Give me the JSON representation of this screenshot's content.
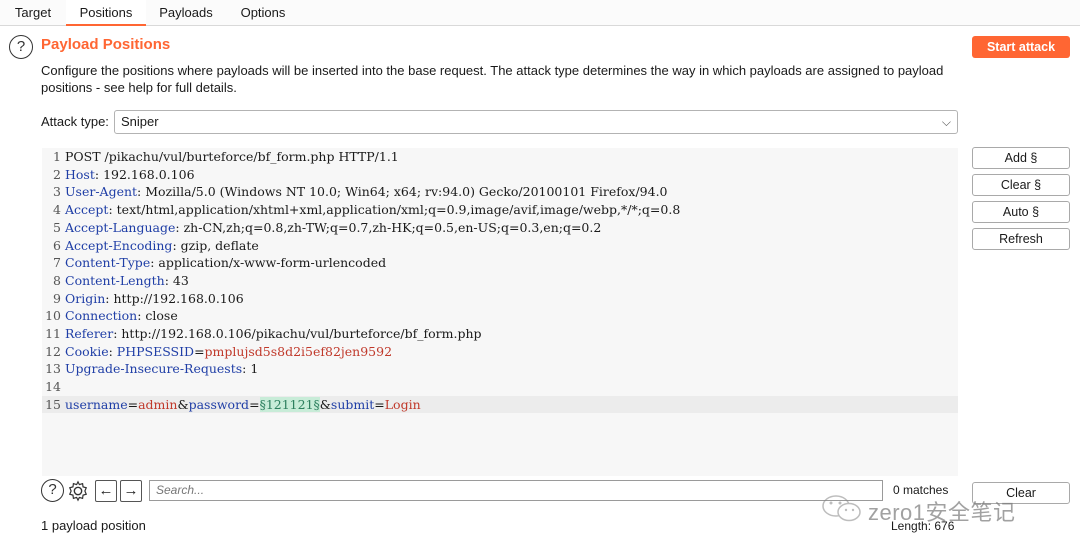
{
  "tabs": [
    {
      "label": "Target",
      "active": false
    },
    {
      "label": "Positions",
      "active": true
    },
    {
      "label": "Payloads",
      "active": false
    },
    {
      "label": "Options",
      "active": false
    }
  ],
  "header": {
    "title": "Payload Positions",
    "start_attack_label": "Start attack",
    "description": "Configure the positions where payloads will be inserted into the base request. The attack type determines the way in which payloads are assigned to payload positions - see help for full details."
  },
  "attack_type": {
    "label": "Attack type:",
    "value": "Sniper"
  },
  "request_lines": [
    {
      "num": "1",
      "text": "POST /pikachu/vul/burteforce/bf_form.php HTTP/1.1"
    },
    {
      "num": "2",
      "name": "Host",
      "value": " 192.168.0.106"
    },
    {
      "num": "3",
      "name": "User-Agent",
      "value": " Mozilla/5.0 (Windows NT 10.0; Win64; x64; rv:94.0) Gecko/20100101 Firefox/94.0"
    },
    {
      "num": "4",
      "name": "Accept",
      "value": " text/html,application/xhtml+xml,application/xml;q=0.9,image/avif,image/webp,*/*;q=0.8"
    },
    {
      "num": "5",
      "name": "Accept-Language",
      "value": " zh-CN,zh;q=0.8,zh-TW;q=0.7,zh-HK;q=0.5,en-US;q=0.3,en;q=0.2"
    },
    {
      "num": "6",
      "name": "Accept-Encoding",
      "value": " gzip, deflate"
    },
    {
      "num": "7",
      "name": "Content-Type",
      "value": " application/x-www-form-urlencoded"
    },
    {
      "num": "8",
      "name": "Content-Length",
      "value": " 43"
    },
    {
      "num": "9",
      "name": "Origin",
      "value": " http://192.168.0.106"
    },
    {
      "num": "10",
      "name": "Connection",
      "value": " close"
    },
    {
      "num": "11",
      "name": "Referer",
      "value": " http://192.168.0.106/pikachu/vul/burteforce/bf_form.php"
    },
    {
      "num": "12",
      "name": "Cookie",
      "cookie_name": "PHPSESSID",
      "cookie_value": "pmplujsd5s8d2i5ef82jen9592"
    },
    {
      "num": "13",
      "name": "Upgrade-Insecure-Requests",
      "value": " 1"
    },
    {
      "num": "14",
      "text": ""
    },
    {
      "num": "15",
      "body": {
        "p1": "username",
        "v1": "admin",
        "p2": "password",
        "marked": "§121121§",
        "p3": "submit",
        "v3": "Login"
      }
    }
  ],
  "side_buttons": {
    "add": "Add §",
    "clear": "Clear §",
    "auto": "Auto §",
    "refresh": "Refresh"
  },
  "search": {
    "placeholder": "Search...",
    "matches": "0 matches",
    "clear_label": "Clear"
  },
  "status": {
    "payload_positions": "1 payload position",
    "length": "Length: 676"
  },
  "watermark": "zero1安全笔记",
  "colors": {
    "accent": "#ff6633",
    "header_name": "#1f3ea6",
    "cookie_value": "#c0392b",
    "payload_bg": "#c8ecd8"
  }
}
